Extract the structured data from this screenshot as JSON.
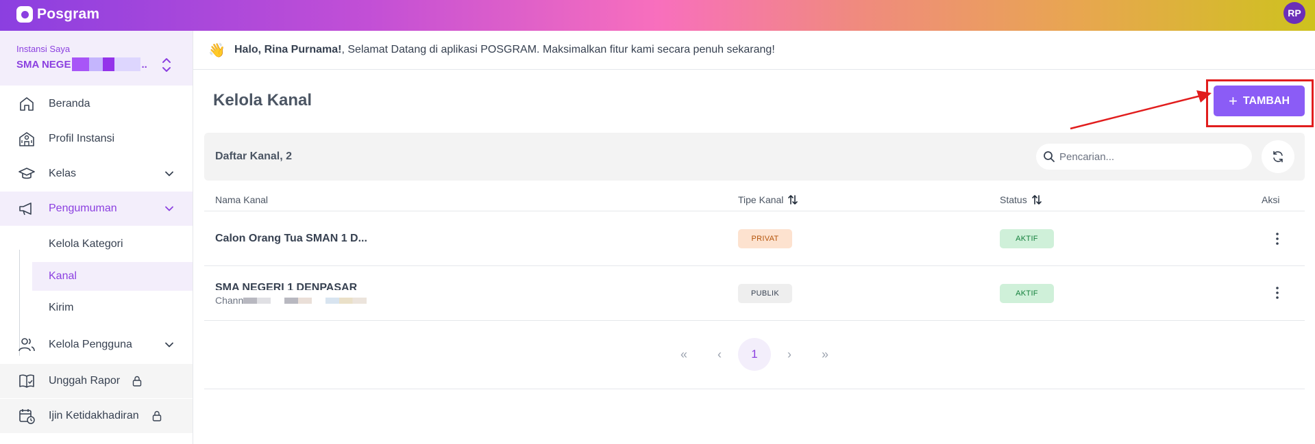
{
  "app": {
    "name": "Posgram",
    "avatar_initials": "RP"
  },
  "institution": {
    "label": "Instansi Saya",
    "name": "SMA NEGE",
    "ellipsis": ".."
  },
  "sidebar": {
    "items": [
      {
        "label": "Beranda"
      },
      {
        "label": "Profil Instansi"
      },
      {
        "label": "Kelas"
      },
      {
        "label": "Pengumuman"
      },
      {
        "label": "Kelola Pengguna"
      },
      {
        "label": "Unggah Rapor"
      },
      {
        "label": "Ijin Ketidakhadiran"
      }
    ],
    "sub_items": [
      {
        "label": "Kelola Kategori"
      },
      {
        "label": "Kanal"
      },
      {
        "label": "Kirim"
      }
    ]
  },
  "greeting": {
    "name": "Halo, Rina Purnama!",
    "message": ", Selamat Datang di aplikasi POSGRAM. Maksimalkan fitur kami secara penuh sekarang!"
  },
  "page": {
    "title": "Kelola Kanal",
    "add_button": "TAMBAH"
  },
  "panel": {
    "title": "Daftar Kanal, 2",
    "search_placeholder": "Pencarian..."
  },
  "table": {
    "headers": {
      "name": "Nama Kanal",
      "type": "Tipe Kanal",
      "status": "Status",
      "action": "Aksi"
    },
    "rows": [
      {
        "name": "Calon Orang Tua SMAN 1 D...",
        "type": "PRIVAT",
        "status": "AKTIF"
      },
      {
        "name": "SMA NEGERI 1 DENPASAR",
        "sub": "Channe",
        "type": "PUBLIK",
        "status": "AKTIF"
      }
    ]
  },
  "pagination": {
    "current": "1",
    "first": "«",
    "prev": "‹",
    "next": "›",
    "last": "»"
  },
  "colors": {
    "accent": "#8b5cf6",
    "brand": "#8b3fe0",
    "highlight": "#e11d1d"
  }
}
